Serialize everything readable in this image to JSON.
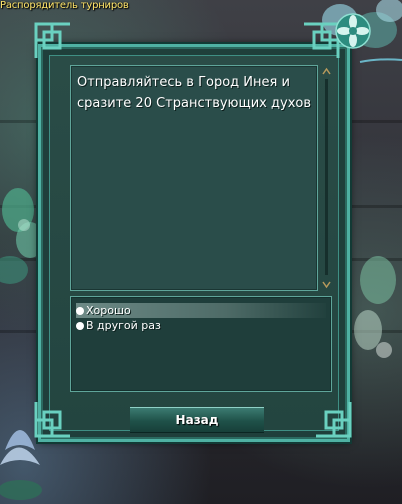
{
  "window_title": "Распорядитель турниров",
  "dialog": {
    "message": "Отправляйтесь в Город Инея и сразите 20 Странствующих духов",
    "options": [
      {
        "label": "Хорошо",
        "selected": true
      },
      {
        "label": "В другой раз",
        "selected": false
      }
    ],
    "back_label": "Назад"
  },
  "icons": {
    "corner_ornament": "celtic-knot-corner-icon",
    "flower": "lotus-flower-icon",
    "scroll_up": "scroll-up-arrow-icon",
    "scroll_down": "scroll-down-arrow-icon",
    "option_bullet": "bullet-dot-icon"
  },
  "colors": {
    "frame": "#4fb1a3",
    "panel": "#2a4d4a",
    "title_text": "#ffe56a",
    "text": "#ffffff"
  }
}
